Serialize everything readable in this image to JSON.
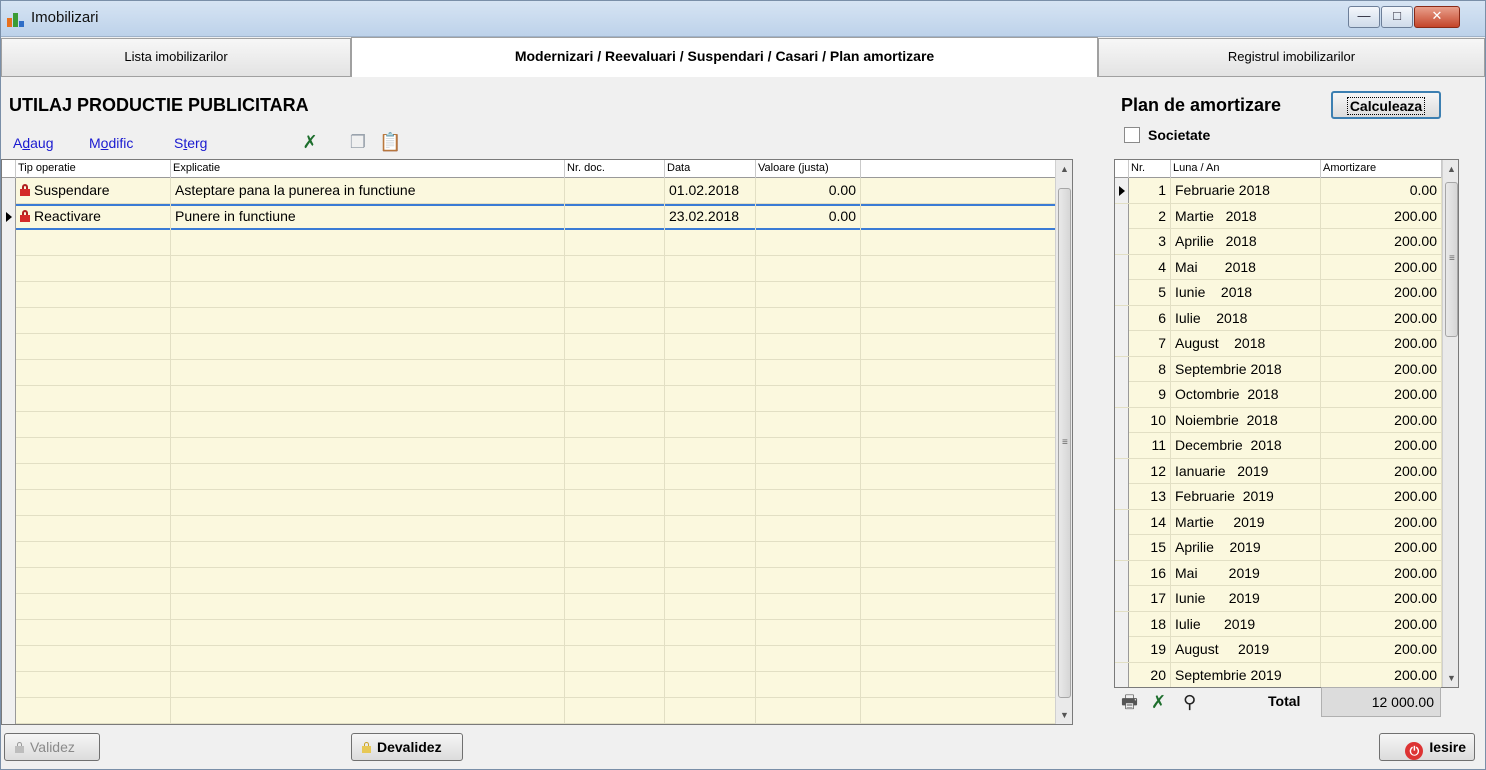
{
  "window": {
    "title": "Imobilizari",
    "minimize": "—",
    "maximize": "□",
    "close": "✕"
  },
  "tabs": [
    {
      "label": "Lista imobilizarilor"
    },
    {
      "label": "Modernizari / Reevaluari / Suspendari / Casari / Plan amortizare"
    },
    {
      "label": "Registrul imobilizarilor"
    }
  ],
  "heading": "UTILAJ PRODUCTIE PUBLICITARA",
  "toolbar": {
    "add": "Adaug",
    "modify": "Modific",
    "delete": "Sterg"
  },
  "operations": {
    "headers": {
      "tip": "Tip operatie",
      "explicatie": "Explicatie",
      "nr_doc": "Nr. doc.",
      "data": "Data",
      "valoare": "Valoare (justa)"
    },
    "rows": [
      {
        "tip": "Suspendare",
        "explicatie": "Asteptare pana la punerea in functiune",
        "nr_doc": "",
        "data": "01.02.2018",
        "valoare": "0.00"
      },
      {
        "tip": "Reactivare",
        "explicatie": "Punere in functiune",
        "nr_doc": "",
        "data": "23.02.2018",
        "valoare": "0.00"
      }
    ]
  },
  "plan": {
    "title": "Plan de amortizare",
    "calc_button": "Calculeaza",
    "societate_label": "Societate",
    "headers": {
      "nr": "Nr.",
      "luna": "Luna / An",
      "amortizare": "Amortizare"
    },
    "rows": [
      {
        "nr": "1",
        "luna": "Februarie 2018",
        "amortizare": "0.00"
      },
      {
        "nr": "2",
        "luna": "Martie   2018",
        "amortizare": "200.00"
      },
      {
        "nr": "3",
        "luna": "Aprilie   2018",
        "amortizare": "200.00"
      },
      {
        "nr": "4",
        "luna": "Mai       2018",
        "amortizare": "200.00"
      },
      {
        "nr": "5",
        "luna": "Iunie    2018",
        "amortizare": "200.00"
      },
      {
        "nr": "6",
        "luna": "Iulie    2018",
        "amortizare": "200.00"
      },
      {
        "nr": "7",
        "luna": "August    2018",
        "amortizare": "200.00"
      },
      {
        "nr": "8",
        "luna": "Septembrie 2018",
        "amortizare": "200.00"
      },
      {
        "nr": "9",
        "luna": "Octombrie  2018",
        "amortizare": "200.00"
      },
      {
        "nr": "10",
        "luna": "Noiembrie  2018",
        "amortizare": "200.00"
      },
      {
        "nr": "11",
        "luna": "Decembrie  2018",
        "amortizare": "200.00"
      },
      {
        "nr": "12",
        "luna": "Ianuarie   2019",
        "amortizare": "200.00"
      },
      {
        "nr": "13",
        "luna": "Februarie  2019",
        "amortizare": "200.00"
      },
      {
        "nr": "14",
        "luna": "Martie     2019",
        "amortizare": "200.00"
      },
      {
        "nr": "15",
        "luna": "Aprilie    2019",
        "amortizare": "200.00"
      },
      {
        "nr": "16",
        "luna": "Mai        2019",
        "amortizare": "200.00"
      },
      {
        "nr": "17",
        "luna": "Iunie      2019",
        "amortizare": "200.00"
      },
      {
        "nr": "18",
        "luna": "Iulie      2019",
        "amortizare": "200.00"
      },
      {
        "nr": "19",
        "luna": "August     2019",
        "amortizare": "200.00"
      },
      {
        "nr": "20",
        "luna": "Septembrie 2019",
        "amortizare": "200.00"
      }
    ],
    "total_label": "Total",
    "total_value": "12 000.00"
  },
  "buttons": {
    "validez": "Validez",
    "devalidez": "Devalidez",
    "iesire": "Iesire"
  },
  "icons": {
    "excel": "excel-export-icon",
    "copy": "copy-icon",
    "paste": "paste-icon",
    "print": "print-icon",
    "find": "binoculars-icon",
    "lock": "lock-icon",
    "power": "power-icon"
  },
  "colors": {
    "grid_background": "#fbf8de",
    "link_blue": "#1a1ad0",
    "lock_red": "#d42a2a",
    "selection_outline": "#3a7bd5"
  }
}
